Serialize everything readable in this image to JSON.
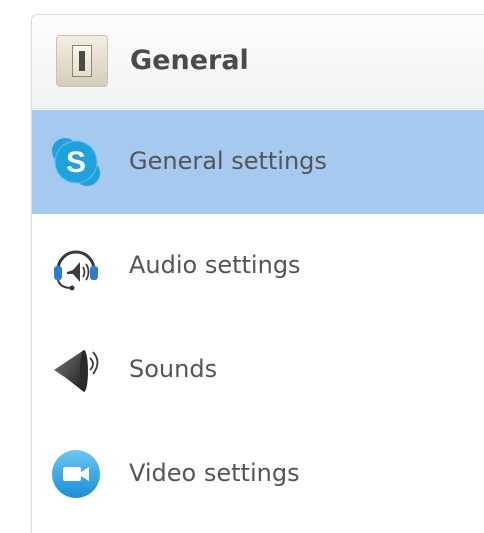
{
  "header": {
    "title": "General",
    "icon": "light-switch-icon"
  },
  "menu": {
    "selected_index": 0,
    "items": [
      {
        "label": "General settings",
        "icon": "skype-icon"
      },
      {
        "label": "Audio settings",
        "icon": "headset-speaker-icon"
      },
      {
        "label": "Sounds",
        "icon": "speaker-icon"
      },
      {
        "label": "Video settings",
        "icon": "video-camera-icon"
      }
    ]
  },
  "colors": {
    "selected_background": "#a5c9ef",
    "skype_blue": "#1fa1de",
    "text": "#555555"
  }
}
